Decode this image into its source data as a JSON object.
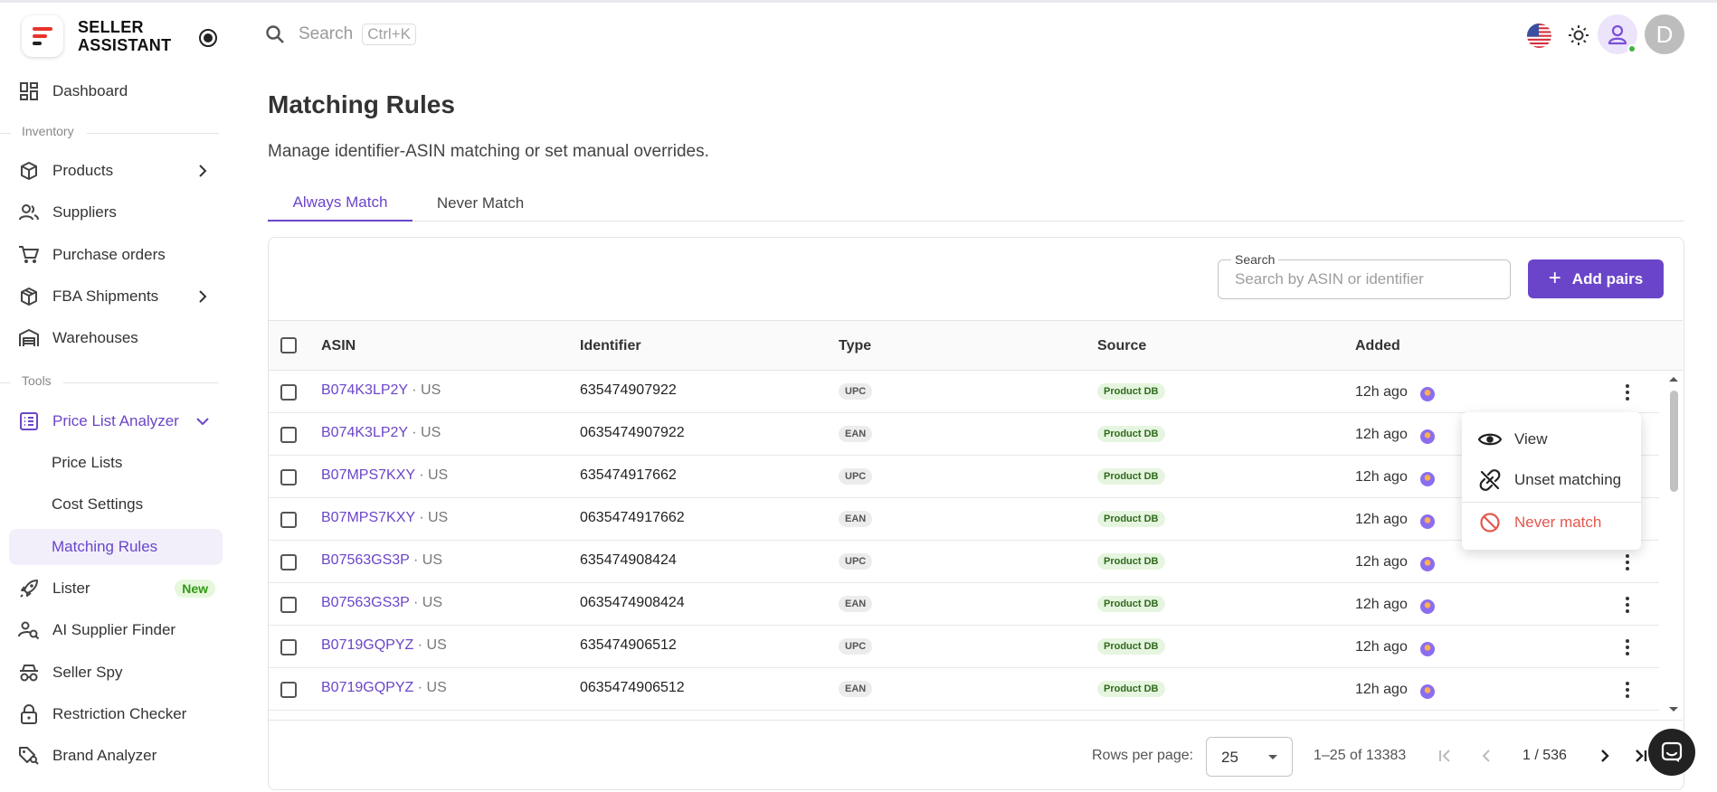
{
  "brand": {
    "line1": "SELLER",
    "line2": "ASSISTANT"
  },
  "sidebar": {
    "dashboard": "Dashboard",
    "section_inventory": "Inventory",
    "products": "Products",
    "suppliers": "Suppliers",
    "purchase_orders": "Purchase orders",
    "fba_shipments": "FBA Shipments",
    "warehouses": "Warehouses",
    "section_tools": "Tools",
    "price_list_analyzer": "Price List Analyzer",
    "price_lists": "Price Lists",
    "cost_settings": "Cost Settings",
    "matching_rules": "Matching Rules",
    "lister": "Lister",
    "lister_badge": "New",
    "ai_supplier_finder": "AI Supplier Finder",
    "seller_spy": "Seller Spy",
    "restriction_checker": "Restriction Checker",
    "brand_analyzer": "Brand Analyzer"
  },
  "topbar": {
    "search_placeholder": "Search",
    "search_shortcut": "Ctrl+K",
    "user_initial": "D"
  },
  "page": {
    "title": "Matching Rules",
    "subtitle": "Manage identifier-ASIN matching or set manual overrides."
  },
  "tabs": [
    "Always Match",
    "Never Match"
  ],
  "toolbar": {
    "search_label": "Search",
    "search_placeholder": "Search by ASIN or identifier",
    "add_button": "Add pairs"
  },
  "table": {
    "columns": [
      "ASIN",
      "Identifier",
      "Type",
      "Source",
      "Added"
    ],
    "rows": [
      {
        "asin": "B074K3LP2Y",
        "market": "· US",
        "identifier": "635474907922",
        "type": "UPC",
        "source": "Product DB",
        "added": "12h ago"
      },
      {
        "asin": "B074K3LP2Y",
        "market": "· US",
        "identifier": "0635474907922",
        "type": "EAN",
        "source": "Product DB",
        "added": "12h ago"
      },
      {
        "asin": "B07MPS7KXY",
        "market": "· US",
        "identifier": "635474917662",
        "type": "UPC",
        "source": "Product DB",
        "added": "12h ago"
      },
      {
        "asin": "B07MPS7KXY",
        "market": "· US",
        "identifier": "0635474917662",
        "type": "EAN",
        "source": "Product DB",
        "added": "12h ago"
      },
      {
        "asin": "B07563GS3P",
        "market": "· US",
        "identifier": "635474908424",
        "type": "UPC",
        "source": "Product DB",
        "added": "12h ago"
      },
      {
        "asin": "B07563GS3P",
        "market": "· US",
        "identifier": "0635474908424",
        "type": "EAN",
        "source": "Product DB",
        "added": "12h ago"
      },
      {
        "asin": "B0719GQPYZ",
        "market": "· US",
        "identifier": "635474906512",
        "type": "UPC",
        "source": "Product DB",
        "added": "12h ago"
      },
      {
        "asin": "B0719GQPYZ",
        "market": "· US",
        "identifier": "0635474906512",
        "type": "EAN",
        "source": "Product DB",
        "added": "12h ago"
      }
    ]
  },
  "context_menu": {
    "view": "View",
    "unset": "Unset matching",
    "never": "Never match"
  },
  "footer": {
    "rows_per_page_label": "Rows per page:",
    "rows_per_page": "25",
    "range": "1–25 of 13383",
    "page": "1 / 536"
  },
  "colors": {
    "accent": "#6b45c9",
    "danger": "#e2584e",
    "source_chip": "#e6f5df"
  }
}
